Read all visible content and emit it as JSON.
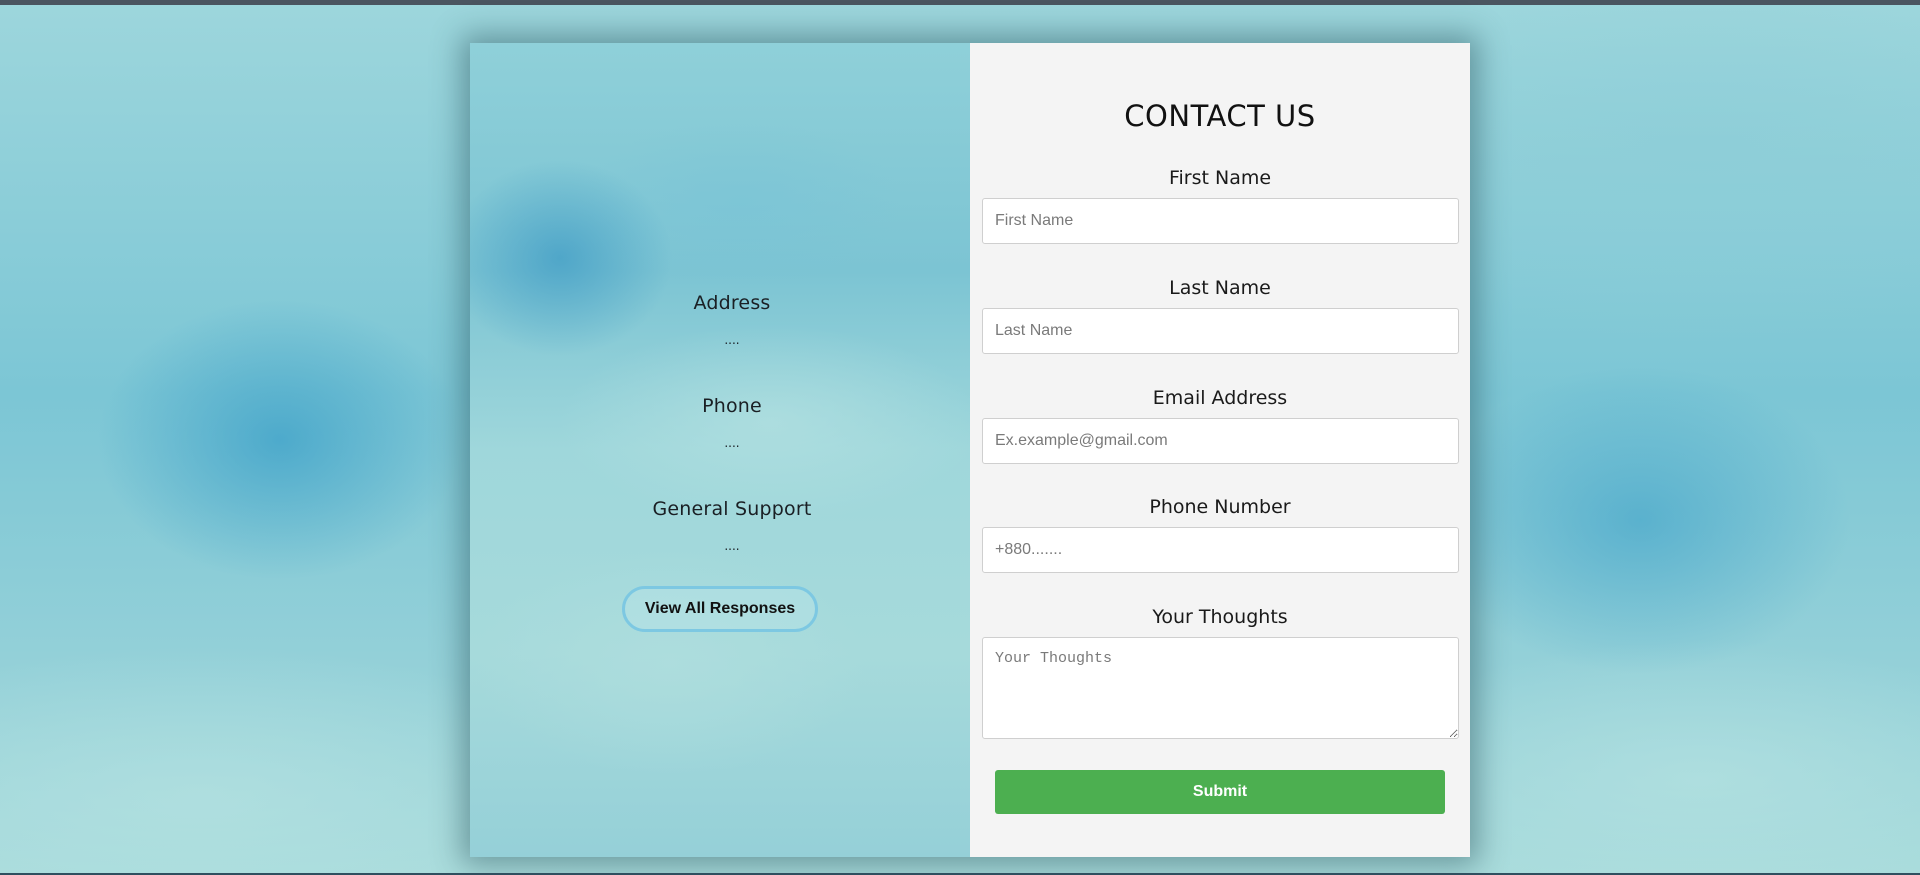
{
  "left_panel": {
    "sections": [
      {
        "heading": "Address",
        "value": "...."
      },
      {
        "heading": "Phone",
        "value": "...."
      },
      {
        "heading": "General Support",
        "value": "...."
      }
    ],
    "view_button_label": "View All Responses"
  },
  "form": {
    "title": "CONTACT US",
    "fields": {
      "first_name": {
        "label": "First Name",
        "placeholder": "First Name",
        "value": ""
      },
      "last_name": {
        "label": "Last Name",
        "placeholder": "Last Name",
        "value": ""
      },
      "email": {
        "label": "Email Address",
        "placeholder": "Ex.example@gmail.com",
        "value": ""
      },
      "phone": {
        "label": "Phone Number",
        "placeholder": "+880.......",
        "value": ""
      },
      "thoughts": {
        "label": "Your Thoughts",
        "placeholder": "Your Thoughts",
        "value": ""
      }
    },
    "submit_label": "Submit",
    "submit_color": "#4caf50"
  },
  "colors": {
    "form_background": "#f4f4f4",
    "view_button_border": "#7dc8e2"
  }
}
